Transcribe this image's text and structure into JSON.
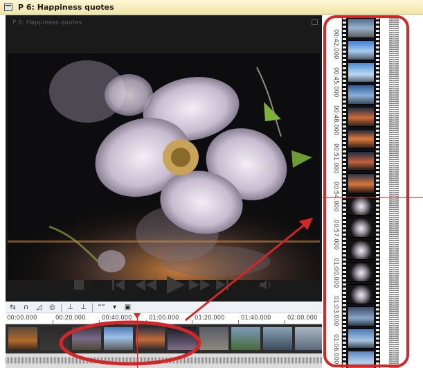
{
  "window": {
    "title": "P 6: Happiness quotes"
  },
  "preview": {
    "overlay_title": "P 6: Happiness quotes"
  },
  "transport": {
    "buttons": [
      "stop-icon",
      "skip-start-icon",
      "rewind-icon",
      "play-icon",
      "fast-forward-icon",
      "skip-end-icon",
      "volume-icon"
    ]
  },
  "timeline_toolbar": {
    "icons": [
      "loop-icon",
      "headphones-icon",
      "volume-ramp-icon",
      "disc-icon",
      "marker-icon",
      "split-icon",
      "quote-icon",
      "dropdown-arrow-icon",
      "screen-icon"
    ],
    "quote_label": "“”"
  },
  "ruler": {
    "labels": [
      "00:00.000",
      "00:20.000",
      "00:40.000",
      "01:00.000",
      "01:20.000",
      "01:40.000",
      "02:00.000"
    ]
  },
  "vertical_ruler": {
    "labels": [
      "00:42.000",
      "00:45.000",
      "00:48.000",
      "00:51.000",
      "00:54.000",
      "00:57.000",
      "01:00.000",
      "01:03.000",
      "01:06.000"
    ]
  },
  "colors": {
    "annotation_red": "#d42626",
    "title_bar": "#f1e4a8",
    "preview_bg": "#1a1a1a"
  }
}
